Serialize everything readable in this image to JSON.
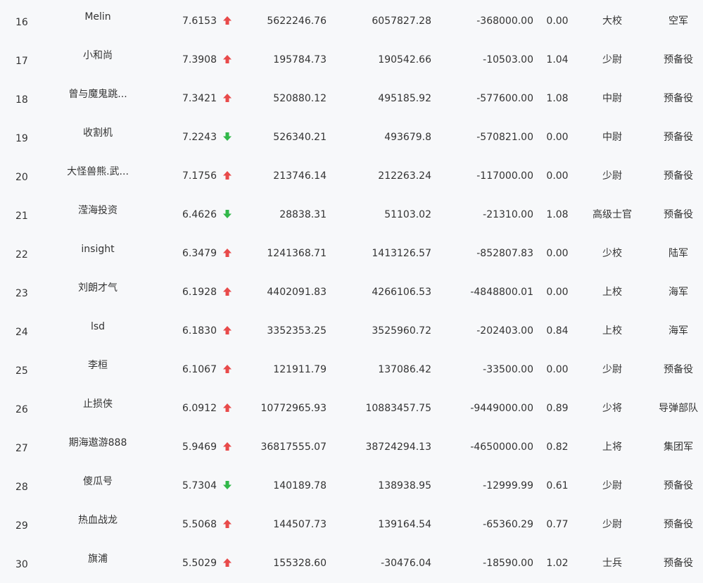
{
  "colors": {
    "up": "#e84a4a",
    "down": "#32b84a",
    "text": "#333333",
    "background": "#f7f8fa"
  },
  "rows": [
    {
      "rank": "16",
      "name": "Melin",
      "score": "7.6153",
      "trend": "up",
      "v1": "5622246.76",
      "v2": "6057827.28",
      "v3": "-368000.00",
      "ratio": "0.00",
      "title": "大校",
      "unit": "空军"
    },
    {
      "rank": "17",
      "name": "小和尚",
      "score": "7.3908",
      "trend": "up",
      "v1": "195784.73",
      "v2": "190542.66",
      "v3": "-10503.00",
      "ratio": "1.04",
      "title": "少尉",
      "unit": "预备役"
    },
    {
      "rank": "18",
      "name": "曾与魔鬼跳...",
      "score": "7.3421",
      "trend": "up",
      "v1": "520880.12",
      "v2": "495185.92",
      "v3": "-577600.00",
      "ratio": "1.08",
      "title": "中尉",
      "unit": "预备役"
    },
    {
      "rank": "19",
      "name": "收割机",
      "score": "7.2243",
      "trend": "down",
      "v1": "526340.21",
      "v2": "493679.8",
      "v3": "-570821.00",
      "ratio": "0.00",
      "title": "中尉",
      "unit": "预备役"
    },
    {
      "rank": "20",
      "name": "大怪兽熊.武...",
      "score": "7.1756",
      "trend": "up",
      "v1": "213746.14",
      "v2": "212263.24",
      "v3": "-117000.00",
      "ratio": "0.00",
      "title": "少尉",
      "unit": "预备役"
    },
    {
      "rank": "21",
      "name": "滢海投资",
      "score": "6.4626",
      "trend": "down",
      "v1": "28838.31",
      "v2": "51103.02",
      "v3": "-21310.00",
      "ratio": "1.08",
      "title": "高级士官",
      "unit": "预备役"
    },
    {
      "rank": "22",
      "name": "insight",
      "score": "6.3479",
      "trend": "up",
      "v1": "1241368.71",
      "v2": "1413126.57",
      "v3": "-852807.83",
      "ratio": "0.00",
      "title": "少校",
      "unit": "陆军"
    },
    {
      "rank": "23",
      "name": "刘朗才气",
      "score": "6.1928",
      "trend": "up",
      "v1": "4402091.83",
      "v2": "4266106.53",
      "v3": "-4848800.01",
      "ratio": "0.00",
      "title": "上校",
      "unit": "海军"
    },
    {
      "rank": "24",
      "name": "lsd",
      "score": "6.1830",
      "trend": "up",
      "v1": "3352353.25",
      "v2": "3525960.72",
      "v3": "-202403.00",
      "ratio": "0.84",
      "title": "上校",
      "unit": "海军"
    },
    {
      "rank": "25",
      "name": "李桓",
      "score": "6.1067",
      "trend": "up",
      "v1": "121911.79",
      "v2": "137086.42",
      "v3": "-33500.00",
      "ratio": "0.00",
      "title": "少尉",
      "unit": "预备役"
    },
    {
      "rank": "26",
      "name": "止损侠",
      "score": "6.0912",
      "trend": "up",
      "v1": "10772965.93",
      "v2": "10883457.75",
      "v3": "-9449000.00",
      "ratio": "0.89",
      "title": "少将",
      "unit": "导弹部队"
    },
    {
      "rank": "27",
      "name": "期海遨游888",
      "score": "5.9469",
      "trend": "up",
      "v1": "36817555.07",
      "v2": "38724294.13",
      "v3": "-4650000.00",
      "ratio": "0.82",
      "title": "上将",
      "unit": "集团军"
    },
    {
      "rank": "28",
      "name": "傻瓜号",
      "score": "5.7304",
      "trend": "down",
      "v1": "140189.78",
      "v2": "138938.95",
      "v3": "-12999.99",
      "ratio": "0.61",
      "title": "少尉",
      "unit": "预备役"
    },
    {
      "rank": "29",
      "name": "热血战龙",
      "score": "5.5068",
      "trend": "up",
      "v1": "144507.73",
      "v2": "139164.54",
      "v3": "-65360.29",
      "ratio": "0.77",
      "title": "少尉",
      "unit": "预备役"
    },
    {
      "rank": "30",
      "name": "旗浦",
      "score": "5.5029",
      "trend": "up",
      "v1": "155328.60",
      "v2": "-30476.04",
      "v3": "-18590.00",
      "ratio": "1.02",
      "title": "士兵",
      "unit": "预备役"
    }
  ]
}
